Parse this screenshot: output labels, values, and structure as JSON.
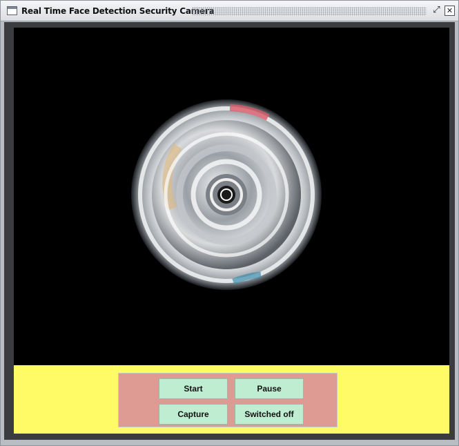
{
  "window": {
    "title": "Real Time Face Detection Security Camera",
    "restore_icon": "restore-icon",
    "close_icon": "close-icon"
  },
  "controls": {
    "start": "Start",
    "pause": "Pause",
    "capture": "Capture",
    "switch_off": "Switched off"
  },
  "colors": {
    "video_background": "#000000",
    "control_strip": "#fffb66",
    "button_group": "#de9b93",
    "button": "#bfedd1"
  }
}
